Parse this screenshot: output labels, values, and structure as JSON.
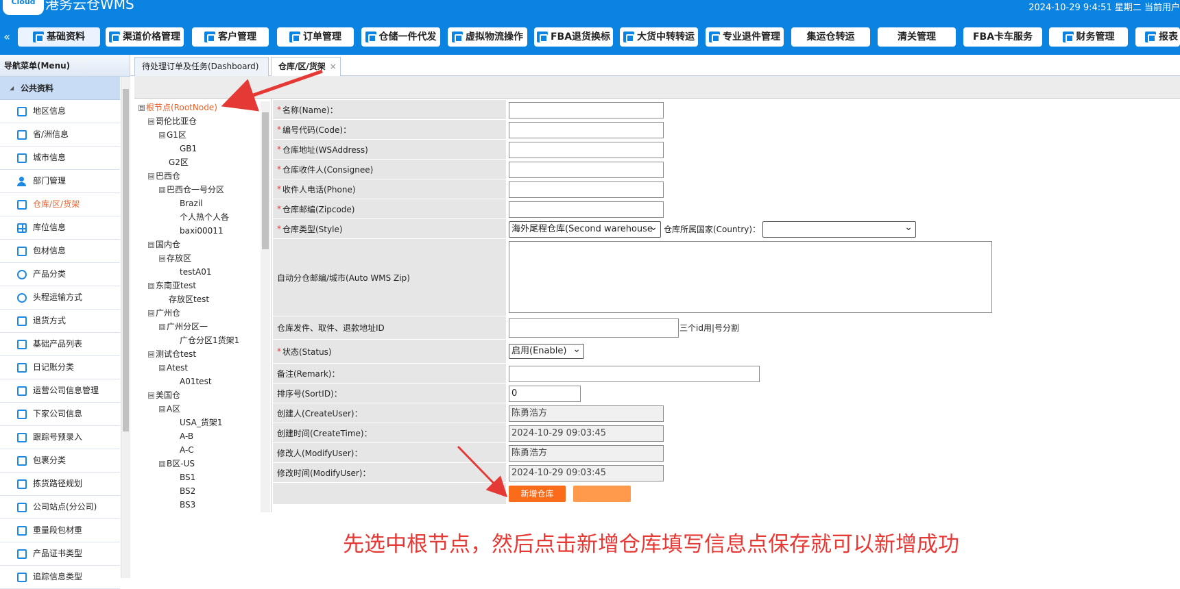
{
  "header": {
    "logo": "Cloud",
    "title": "港务云仓WMS",
    "datetime": "2024-10-29 9:4:51   星期二   当前用户",
    "nav": [
      {
        "label": "基础资料"
      },
      {
        "label": "渠道价格管理"
      },
      {
        "label": "客户管理"
      },
      {
        "label": "订单管理"
      },
      {
        "label": "仓储一件代发"
      },
      {
        "label": "虚拟物流操作"
      },
      {
        "label": "FBA退货换标"
      },
      {
        "label": "大货中转转运"
      },
      {
        "label": "专业退件管理"
      },
      {
        "label": "集运仓转运"
      },
      {
        "label": "清关管理"
      },
      {
        "label": "FBA卡车服务"
      },
      {
        "label": "财务管理"
      },
      {
        "label": "报表"
      }
    ]
  },
  "sidebar": {
    "title": "导航菜单(Menu)",
    "section": "公共资料",
    "items": [
      {
        "label": "地区信息"
      },
      {
        "label": "省/洲信息"
      },
      {
        "label": "城市信息"
      },
      {
        "label": "部门管理"
      },
      {
        "label": "仓库/区/货架"
      },
      {
        "label": "库位信息"
      },
      {
        "label": "包材信息"
      },
      {
        "label": "产品分类"
      },
      {
        "label": "头程运输方式"
      },
      {
        "label": "退货方式"
      },
      {
        "label": "基础产品列表"
      },
      {
        "label": "日记账分类"
      },
      {
        "label": "运营公司信息管理"
      },
      {
        "label": "下家公司信息"
      },
      {
        "label": "跟踪号预录入"
      },
      {
        "label": "包裹分类"
      },
      {
        "label": "拣货路径规划"
      },
      {
        "label": "公司站点(分公司)"
      },
      {
        "label": "重量段包材重"
      },
      {
        "label": "产品证书类型"
      },
      {
        "label": "追踪信息类型"
      }
    ]
  },
  "tabs": [
    {
      "label": "待处理订单及任务(Dashboard)"
    },
    {
      "label": "仓库/区/货架",
      "close": "×"
    }
  ],
  "tree": [
    {
      "label": "根节点(RootNode)",
      "exp": "⊟"
    },
    {
      "label": "哥伦比亚仓",
      "exp": "⊟"
    },
    {
      "label": "G1区",
      "exp": "⊟"
    },
    {
      "label": "GB1"
    },
    {
      "label": "G2区"
    },
    {
      "label": "巴西仓",
      "exp": "⊟"
    },
    {
      "label": "巴西仓一号分区",
      "exp": "⊟"
    },
    {
      "label": "Brazil"
    },
    {
      "label": "个人热个人各"
    },
    {
      "label": "baxi00011"
    },
    {
      "label": "国内仓",
      "exp": "⊟"
    },
    {
      "label": "存放区",
      "exp": "⊟"
    },
    {
      "label": "testA01"
    },
    {
      "label": "东南亚test",
      "exp": "⊟"
    },
    {
      "label": "存放区test"
    },
    {
      "label": "广州仓",
      "exp": "⊟"
    },
    {
      "label": "广州分区一",
      "exp": "⊟"
    },
    {
      "label": "广仓分区1货架1"
    },
    {
      "label": "测试仓test",
      "exp": "⊟"
    },
    {
      "label": "Atest",
      "exp": "⊟"
    },
    {
      "label": "A01test"
    },
    {
      "label": "美国仓",
      "exp": "⊟"
    },
    {
      "label": "A区",
      "exp": "⊟"
    },
    {
      "label": "USA_货架1"
    },
    {
      "label": "A-B"
    },
    {
      "label": "A-C"
    },
    {
      "label": "B区-US",
      "exp": "⊟"
    },
    {
      "label": "BS1"
    },
    {
      "label": "BS2"
    },
    {
      "label": "BS3"
    }
  ],
  "form": {
    "required_mark": "*",
    "name_label": "名称(Name)：",
    "code_label": "编号代码(Code)：",
    "address_label": "仓库地址(WSAddress)",
    "consignee_label": "仓库收件人(Consignee)",
    "phone_label": "收件人电话(Phone)",
    "zip_label": "仓库邮编(Zipcode)",
    "style_label": "仓库类型(Style)",
    "style_value": "海外尾程仓库(Second warehouse",
    "country_label": "仓库所属国家(Country)：",
    "country_value": "",
    "autozip_label": "自动分仓邮编/城市(Auto WMS Zip)",
    "addrid_label": "仓库发件、取件、退款地址ID",
    "addrid_hint": "三个id用|号分割",
    "status_label": "状态(Status)",
    "status_value": "启用(Enable)",
    "remark_label": "备注(Remark)：",
    "sort_label": "排序号(SortID)：",
    "sort_value": "0",
    "createuser_label": "创建人(CreateUser)：",
    "createuser_value": "陈勇浩方",
    "createtime_label": "创建时间(CreateTime)：",
    "createtime_value": "2024-10-29 09:03:45",
    "modifyuser_label": "修改人(ModifyUser)：",
    "modifyuser_value": "陈勇浩方",
    "modifytime_label": "修改时间(ModifyUser)：",
    "modifytime_value": "2024-10-29 09:03:45",
    "add_button": "新增仓库"
  },
  "note": "先选中根节点，然后点击新增仓库填写信息点保存就可以新增成功",
  "colors": {
    "header": "#0a84e0",
    "accent": "#e8622b",
    "annotation": "#e53935"
  }
}
